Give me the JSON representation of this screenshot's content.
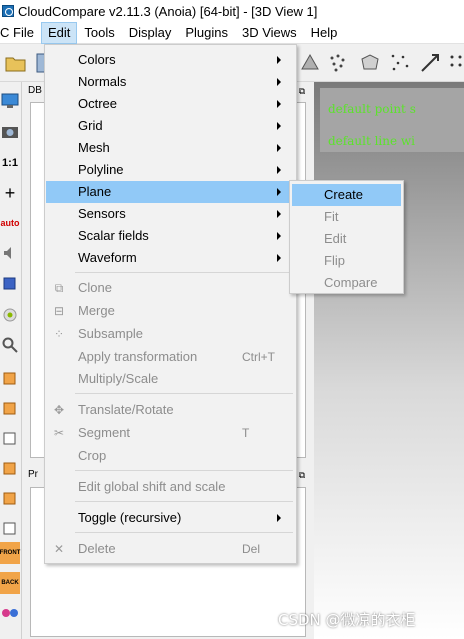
{
  "window": {
    "title": "CloudCompare v2.11.3 (Anoia) [64-bit] - [3D View 1]"
  },
  "menubar": {
    "items": [
      {
        "label": "C File"
      },
      {
        "label": "Edit"
      },
      {
        "label": "Tools"
      },
      {
        "label": "Display"
      },
      {
        "label": "Plugins"
      },
      {
        "label": "3D Views"
      },
      {
        "label": "Help"
      }
    ]
  },
  "left_toolbar": {
    "zoom_label": "1:1",
    "auto_label": "auto",
    "front_label": "FRONT",
    "back_label": "BACK"
  },
  "panels": {
    "db_header": "DB",
    "properties_header": "Pr"
  },
  "view3d": {
    "messages": [
      "default point s",
      "default line wi"
    ],
    "console_color": "#5ce32b"
  },
  "edit_menu": {
    "items": [
      {
        "label": "Colors",
        "submenu": true
      },
      {
        "label": "Normals",
        "submenu": true
      },
      {
        "label": "Octree",
        "submenu": true
      },
      {
        "label": "Grid",
        "submenu": true
      },
      {
        "label": "Mesh",
        "submenu": true
      },
      {
        "label": "Polyline",
        "submenu": true
      },
      {
        "label": "Plane",
        "submenu": true,
        "highlighted": true
      },
      {
        "label": "Sensors",
        "submenu": true
      },
      {
        "label": "Scalar fields",
        "submenu": true
      },
      {
        "label": "Waveform",
        "submenu": true
      },
      {
        "label": "Clone",
        "disabled": true,
        "icon": "clone-icon"
      },
      {
        "label": "Merge",
        "disabled": true,
        "icon": "merge-icon"
      },
      {
        "label": "Subsample",
        "disabled": true,
        "icon": "subsample-icon"
      },
      {
        "label": "Apply transformation",
        "shortcut": "Ctrl+T",
        "disabled": true
      },
      {
        "label": "Multiply/Scale",
        "disabled": true
      },
      {
        "label": "Translate/Rotate",
        "disabled": true,
        "icon": "translate-rotate-icon"
      },
      {
        "label": "Segment",
        "shortcut": "T",
        "disabled": true,
        "icon": "scissors-icon"
      },
      {
        "label": "Crop",
        "disabled": true
      },
      {
        "label": "Edit global shift and scale",
        "disabled": true
      },
      {
        "label": "Toggle (recursive)",
        "submenu": true
      },
      {
        "label": "Delete",
        "shortcut": "Del",
        "disabled": true,
        "icon": "delete-icon"
      }
    ]
  },
  "plane_submenu": {
    "items": [
      {
        "label": "Create",
        "highlighted": true
      },
      {
        "label": "Fit",
        "disabled": true
      },
      {
        "label": "Edit",
        "disabled": true
      },
      {
        "label": "Flip",
        "disabled": true
      },
      {
        "label": "Compare",
        "disabled": true
      }
    ]
  },
  "watermark": "CSDN @微凉的衣柜",
  "colors": {
    "menu_highlight": "#91c9f7",
    "disabled_text": "#8d8d8d",
    "menubar_active": "#cce4f7"
  }
}
